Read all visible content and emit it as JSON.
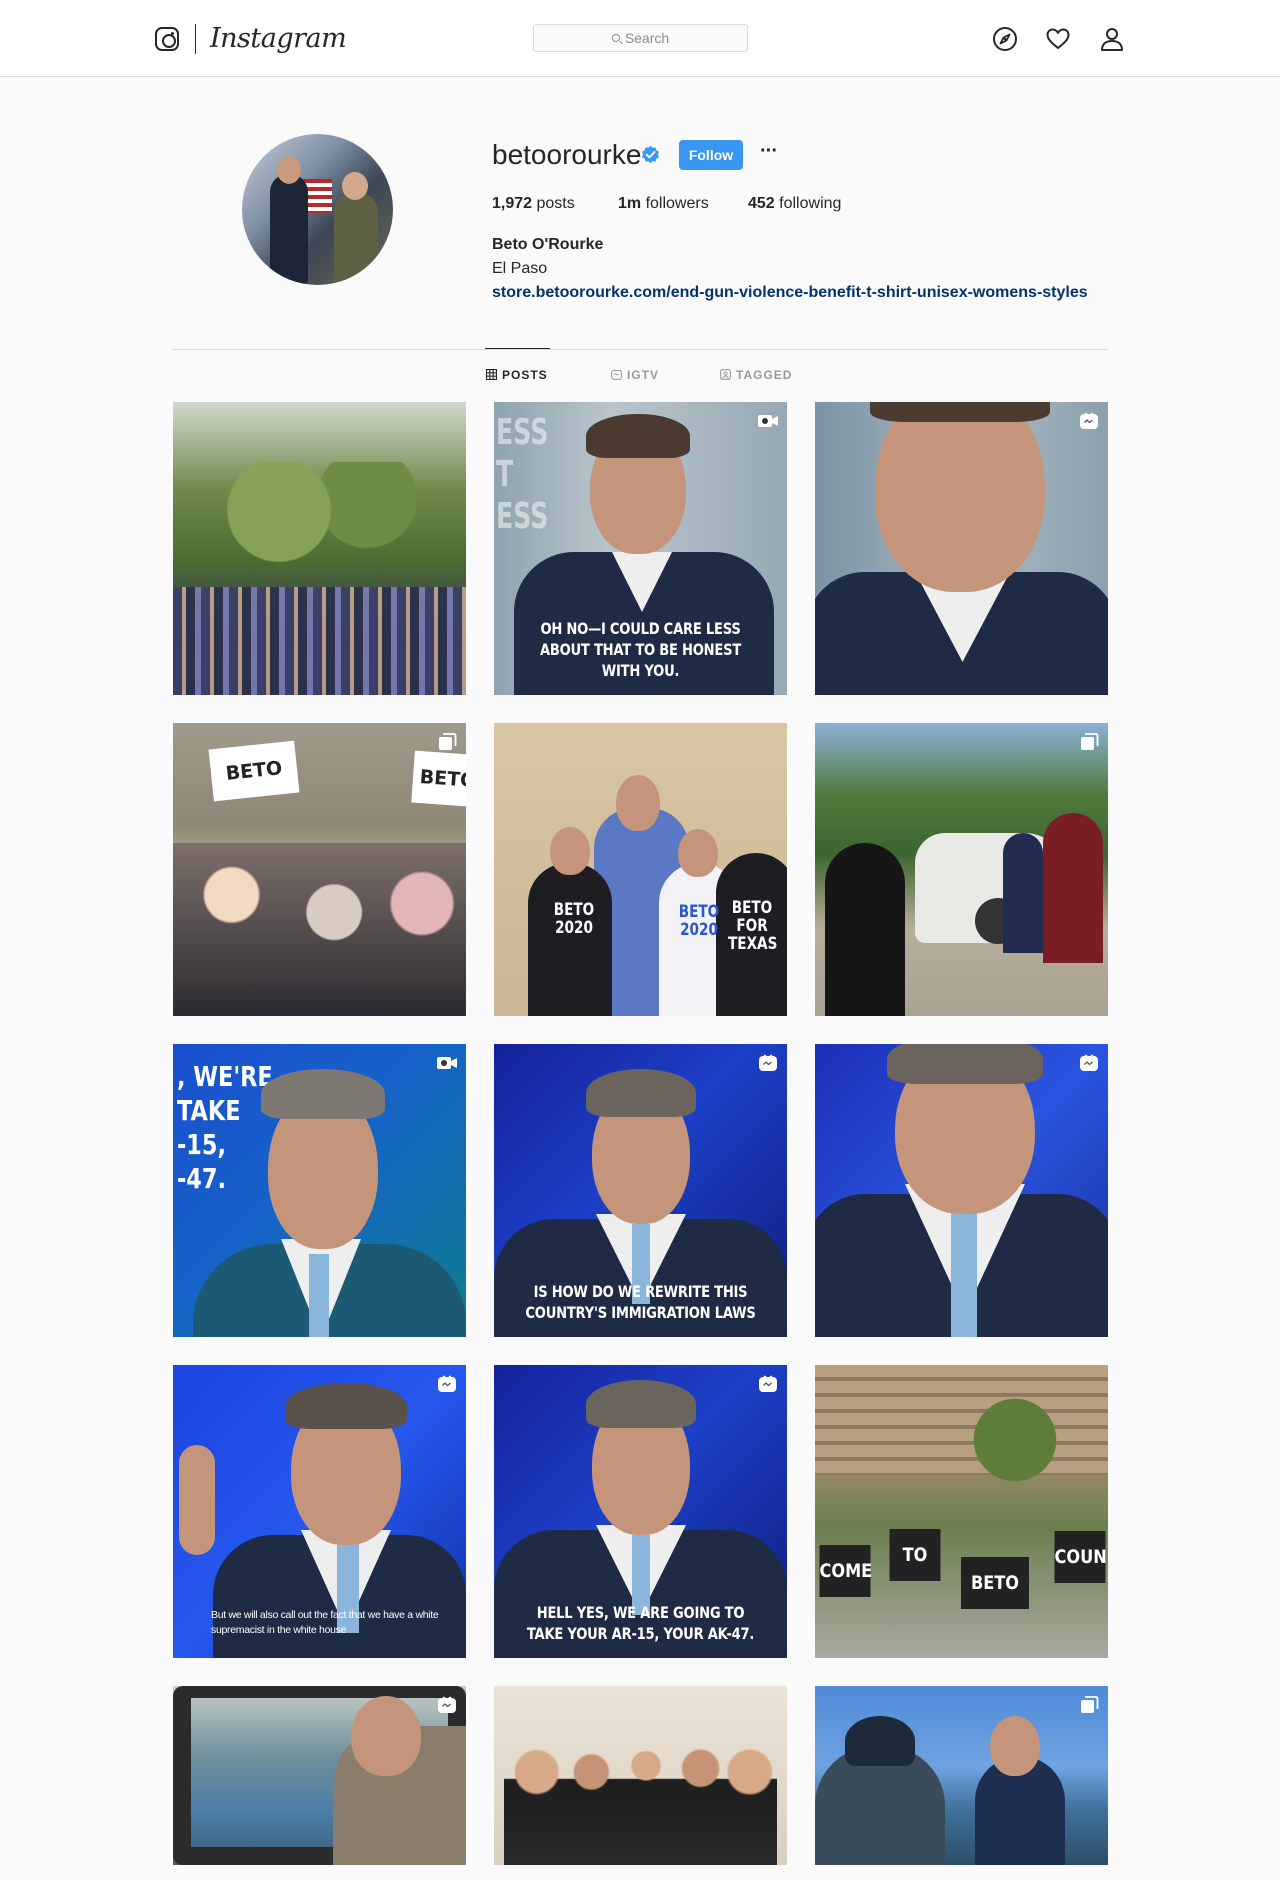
{
  "nav": {
    "brand": "Instagram",
    "search_placeholder": "Search"
  },
  "profile": {
    "username": "betoorourke",
    "verified": true,
    "follow_label": "Follow",
    "more_label": "···",
    "stats": {
      "posts_count": "1,972",
      "posts_label": "posts",
      "followers_count": "1m",
      "followers_label": "followers",
      "following_count": "452",
      "following_label": "following"
    },
    "full_name": "Beto O'Rourke",
    "bio": "El Paso",
    "link": "store.betoorourke.com/end-gun-violence-benefit-t-shirt-unisex-womens-styles"
  },
  "tabs": [
    {
      "label": "POSTS",
      "active": true,
      "icon": "grid-icon"
    },
    {
      "label": "IGTV",
      "active": false,
      "icon": "igtv-icon"
    },
    {
      "label": "TAGGED",
      "active": false,
      "icon": "tagged-icon"
    }
  ],
  "posts": [
    {
      "badge": "none",
      "caption": "",
      "scene": "crowd under trees"
    },
    {
      "badge": "video-icon",
      "caption": "OH NO—I COULD CARE LESS ABOUT THAT TO BE HONEST WITH YOU."
    },
    {
      "badge": "igtv-icon",
      "caption": ""
    },
    {
      "badge": "carousel-icon",
      "caption": "",
      "signs": [
        "BETO",
        "BETO"
      ]
    },
    {
      "badge": "none",
      "caption": "",
      "shirts": [
        "BETO 2020",
        "BETO 2020",
        "BETO FOR TEXAS"
      ]
    },
    {
      "badge": "carousel-icon",
      "caption": ""
    },
    {
      "badge": "video-icon",
      "caption": "",
      "overlay": ", WE'RE\nTAKE\n-15,\n-47."
    },
    {
      "badge": "igtv-icon",
      "caption": "IS HOW DO WE REWRITE THIS COUNTRY'S IMMIGRATION LAWS"
    },
    {
      "badge": "igtv-icon",
      "caption": ""
    },
    {
      "badge": "igtv-icon",
      "caption": "But we will also call out the fact that we have a white supremacist in the white house"
    },
    {
      "badge": "igtv-icon",
      "caption": "HELL YES, WE ARE GOING TO TAKE YOUR AR-15, YOUR AK-47."
    },
    {
      "badge": "none",
      "caption": "",
      "signs": [
        "COME",
        "TO",
        "BETO",
        "COUN"
      ]
    },
    {
      "badge": "igtv-icon",
      "caption": ""
    },
    {
      "badge": "none",
      "caption": ""
    },
    {
      "badge": "carousel-icon",
      "caption": ""
    }
  ]
}
